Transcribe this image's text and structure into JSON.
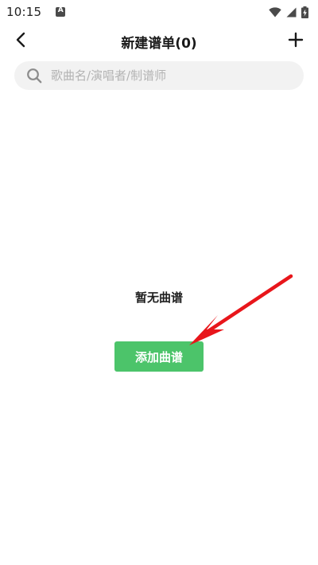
{
  "status_bar": {
    "time": "10:15",
    "icons": [
      "notification-a-icon",
      "wifi-icon",
      "signal-icon",
      "battery-charging-icon"
    ]
  },
  "header": {
    "title": "新建谱单(0)",
    "back_icon": "chevron-left-icon",
    "add_icon": "plus-icon"
  },
  "search": {
    "placeholder": "歌曲名/演唱者/制谱师",
    "value": "",
    "icon": "search-icon"
  },
  "empty_state": {
    "message": "暂无曲谱",
    "button_label": "添加曲谱"
  },
  "colors": {
    "accent_green": "#4cc46a",
    "annotation_red": "#e8161b",
    "search_bg": "#f2f2f2"
  }
}
